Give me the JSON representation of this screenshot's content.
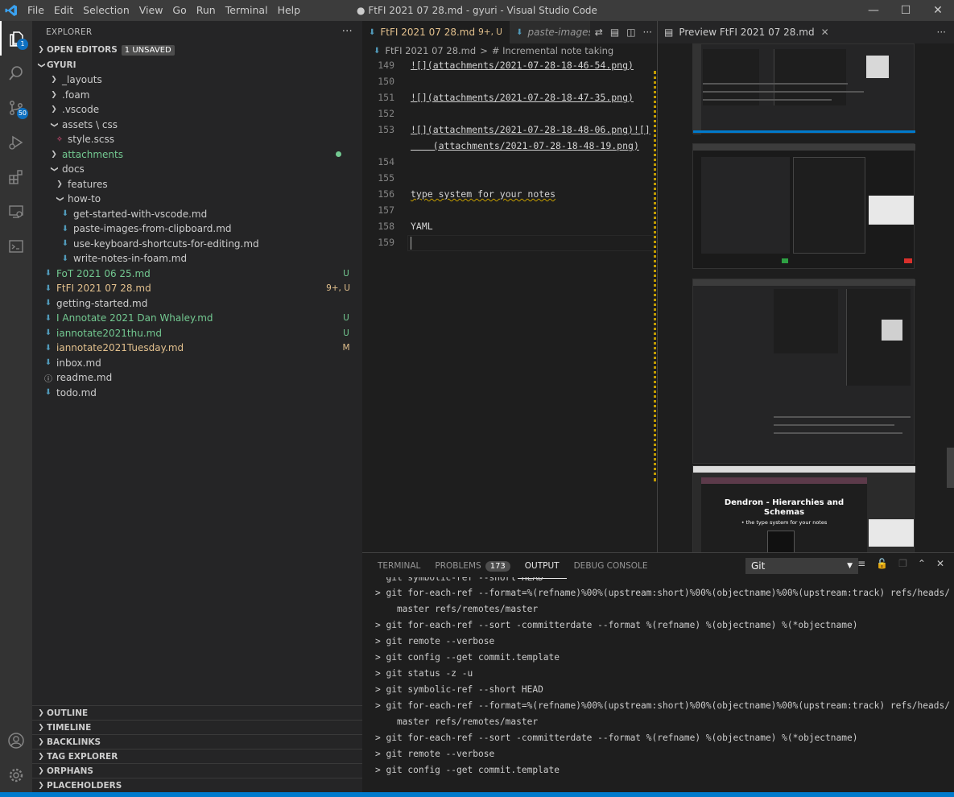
{
  "window": {
    "title": "● FtFI 2021 07 28.md - gyuri - Visual Studio Code",
    "menu": [
      "File",
      "Edit",
      "Selection",
      "View",
      "Go",
      "Run",
      "Terminal",
      "Help"
    ]
  },
  "activity": {
    "explorer_badge": "1",
    "scm_badge": "50"
  },
  "sidebar": {
    "header": "EXPLORER",
    "more": "···",
    "open_editors": "OPEN EDITORS",
    "unsaved": "1 UNSAVED",
    "root": "GYURI",
    "tree": [
      {
        "label": "_layouts",
        "type": "folder",
        "depth": 1,
        "open": false,
        "color": "#cccccc",
        "status": ""
      },
      {
        "label": ".foam",
        "type": "folder",
        "depth": 1,
        "open": false,
        "color": "#cccccc",
        "status": ""
      },
      {
        "label": ".vscode",
        "type": "folder",
        "depth": 1,
        "open": false,
        "color": "#cccccc",
        "status": ""
      },
      {
        "label": "assets \\ css",
        "type": "folder",
        "depth": 1,
        "open": true,
        "color": "#cccccc",
        "status": ""
      },
      {
        "label": "style.scss",
        "type": "scss",
        "depth": 2,
        "color": "#cccccc",
        "status": ""
      },
      {
        "label": "attachments",
        "type": "folder",
        "depth": 1,
        "open": false,
        "color": "#73c991",
        "status": "dot"
      },
      {
        "label": "docs",
        "type": "folder",
        "depth": 1,
        "open": true,
        "color": "#cccccc",
        "status": ""
      },
      {
        "label": "features",
        "type": "folder",
        "depth": 2,
        "open": false,
        "color": "#cccccc",
        "status": ""
      },
      {
        "label": "how-to",
        "type": "folder",
        "depth": 2,
        "open": true,
        "color": "#cccccc",
        "status": ""
      },
      {
        "label": "get-started-with-vscode.md",
        "type": "md",
        "depth": 3,
        "color": "#cccccc",
        "status": ""
      },
      {
        "label": "paste-images-from-clipboard.md",
        "type": "md",
        "depth": 3,
        "color": "#cccccc",
        "status": ""
      },
      {
        "label": "use-keyboard-shortcuts-for-editing.md",
        "type": "md",
        "depth": 3,
        "color": "#cccccc",
        "status": ""
      },
      {
        "label": "write-notes-in-foam.md",
        "type": "md",
        "depth": 3,
        "color": "#cccccc",
        "status": ""
      },
      {
        "label": "FoT 2021 06 25.md",
        "type": "md",
        "depth": 0,
        "color": "#73c991",
        "status": "U"
      },
      {
        "label": "FtFI 2021 07 28.md",
        "type": "md",
        "depth": 0,
        "color": "#e2c08d",
        "status": "9+, U"
      },
      {
        "label": "getting-started.md",
        "type": "md",
        "depth": 0,
        "color": "#cccccc",
        "status": ""
      },
      {
        "label": "I Annotate 2021 Dan Whaley.md",
        "type": "md",
        "depth": 0,
        "color": "#73c991",
        "status": "U"
      },
      {
        "label": "iannotate2021thu.md",
        "type": "md",
        "depth": 0,
        "color": "#73c991",
        "status": "U"
      },
      {
        "label": "iannotate2021Tuesday.md",
        "type": "md",
        "depth": 0,
        "color": "#e2c08d",
        "status": "M"
      },
      {
        "label": "inbox.md",
        "type": "md",
        "depth": 0,
        "color": "#cccccc",
        "status": ""
      },
      {
        "label": "readme.md",
        "type": "info",
        "depth": 0,
        "color": "#cccccc",
        "status": ""
      },
      {
        "label": "todo.md",
        "type": "md",
        "depth": 0,
        "color": "#cccccc",
        "status": ""
      }
    ],
    "sections": [
      "OUTLINE",
      "TIMELINE",
      "BACKLINKS",
      "TAG EXPLORER",
      "ORPHANS",
      "PLACEHOLDERS"
    ]
  },
  "editor": {
    "tab_active": "FtFI 2021 07 28.md",
    "tab_active_status": "9+, U",
    "tab_inactive": "paste-images-fr",
    "breadcrumb_file": "FtFI 2021 07 28.md",
    "breadcrumb_sep": ">",
    "breadcrumb_symbol": "# Incremental note taking",
    "lines": [
      {
        "n": "149",
        "text": "![](attachments/2021-07-28-18-46-54.png)"
      },
      {
        "n": "150",
        "text": ""
      },
      {
        "n": "151",
        "text": "![](attachments/2021-07-28-18-47-35.png)"
      },
      {
        "n": "152",
        "text": ""
      },
      {
        "n": "153",
        "text": "![](attachments/2021-07-28-18-48-06.png)![]"
      },
      {
        "n": "",
        "text": "    (attachments/2021-07-28-18-48-19.png)"
      },
      {
        "n": "154",
        "text": ""
      },
      {
        "n": "155",
        "text": ""
      },
      {
        "n": "156",
        "text": "type system for your notes"
      },
      {
        "n": "157",
        "text": ""
      },
      {
        "n": "158",
        "text": "YAML"
      },
      {
        "n": "159",
        "text": ""
      }
    ]
  },
  "preview": {
    "tab": "Preview FtFI 2021 07 28.md",
    "slide_title": "Dendron - Hierarchies and Schemas",
    "slide_bullet": "• the type system for your notes"
  },
  "panel": {
    "tabs": [
      "TERMINAL",
      "PROBLEMS",
      "OUTPUT",
      "DEBUG CONSOLE"
    ],
    "problems_count": "173",
    "channel": "Git",
    "output": [
      "  git symbolic-ref --short HEAD",
      "> git for-each-ref --format=%(refname)%00%(upstream:short)%00%(objectname)%00%(upstream:track) refs/heads/",
      "    master refs/remotes/master",
      "> git for-each-ref --sort -committerdate --format %(refname) %(objectname) %(*objectname)",
      "> git remote --verbose",
      "> git config --get commit.template",
      "> git status -z -u",
      "> git symbolic-ref --short HEAD",
      "> git for-each-ref --format=%(refname)%00%(upstream:short)%00%(objectname)%00%(upstream:track) refs/heads/",
      "    master refs/remotes/master",
      "> git for-each-ref --sort -committerdate --format %(refname) %(objectname) %(*objectname)",
      "> git remote --verbose",
      "> git config --get commit.template"
    ]
  }
}
